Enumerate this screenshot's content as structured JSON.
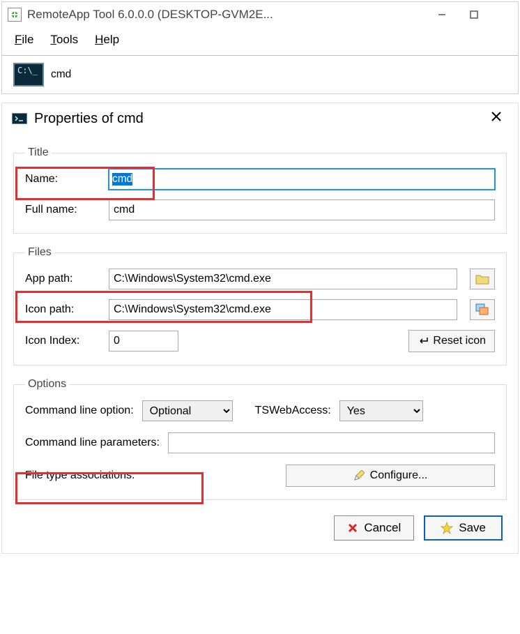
{
  "window": {
    "title": "RemoteApp Tool 6.0.0.0 (DESKTOP-GVM2E..."
  },
  "menu": {
    "file": "File",
    "tools": "Tools",
    "help": "Help"
  },
  "app_list": {
    "item_label": "cmd"
  },
  "dialog": {
    "title": "Properties of cmd",
    "groups": {
      "title": {
        "legend": "Title",
        "name_label": "Name:",
        "name_value": "cmd",
        "fullname_label": "Full name:",
        "fullname_value": "cmd"
      },
      "files": {
        "legend": "Files",
        "apppath_label": "App path:",
        "apppath_value": "C:\\Windows\\System32\\cmd.exe",
        "iconpath_label": "Icon path:",
        "iconpath_value": "C:\\Windows\\System32\\cmd.exe",
        "iconindex_label": "Icon Index:",
        "iconindex_value": "0",
        "reset_icon_label": "Reset icon"
      },
      "options": {
        "legend": "Options",
        "cmdline_option_label": "Command line option:",
        "cmdline_option_value": "Optional",
        "tsweb_label": "TSWebAccess:",
        "tsweb_value": "Yes",
        "cmdline_params_label": "Command line parameters:",
        "cmdline_params_value": "",
        "fileassoc_label": "File type associations:",
        "configure_label": "Configure..."
      }
    },
    "buttons": {
      "cancel": "Cancel",
      "save": "Save"
    }
  }
}
